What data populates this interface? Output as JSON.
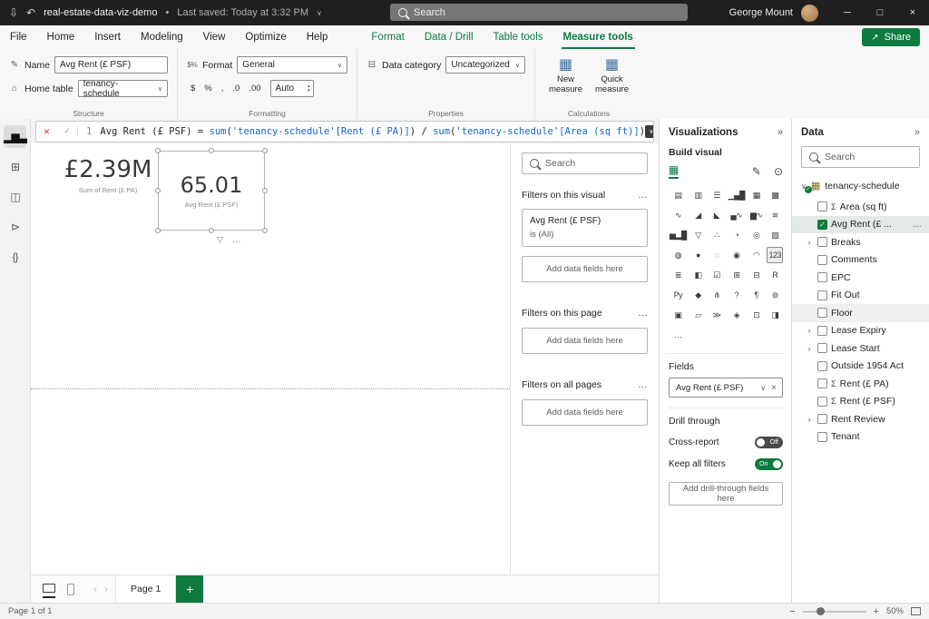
{
  "glyphs": {
    "chevron_down": "∨",
    "chevron_right": "›",
    "collapse": "»",
    "more": "…",
    "check": "✓",
    "close": "×",
    "funnel": "▽",
    "spin_up": "▲",
    "spin_down": "▼",
    "undo": "↶",
    "save": "⇩",
    "share_arrow": "↗",
    "win_min": "─",
    "win_max": "□",
    "win_close": "×",
    "nav_left": "‹",
    "nav_right": "›",
    "zoom_minus": "−",
    "zoom_plus": "+"
  },
  "title_bar": {
    "file_name": "real-estate-data-viz-demo",
    "separator": "•",
    "last_saved": "Last saved: Today at 3:32 PM",
    "search_placeholder": "Search",
    "user_name": "George Mount"
  },
  "ribbon": {
    "tabs": [
      "File",
      "Home",
      "Insert",
      "Modeling",
      "View",
      "Optimize",
      "Help"
    ],
    "contextual_tabs": [
      "Format",
      "Data / Drill",
      "Table tools",
      "Measure tools"
    ],
    "active_contextual_tab": "Measure tools",
    "share_label": "Share",
    "structure": {
      "group_label": "Structure",
      "name_label": "Name",
      "name_value": "Avg Rent (£ PSF)",
      "home_table_label": "Home table",
      "home_table_value": "tenancy-schedule"
    },
    "formatting": {
      "group_label": "Formatting",
      "format_label": "Format",
      "format_value": "General",
      "buttons": [
        "$",
        "%",
        ",",
        ".0",
        ".00"
      ],
      "auto_value": "Auto"
    },
    "properties": {
      "group_label": "Properties",
      "data_category_label": "Data category",
      "data_category_value": "Uncategorized"
    },
    "calculations": {
      "group_label": "Calculations",
      "new_measure_label": "New measure",
      "quick_measure_label": "Quick measure"
    }
  },
  "formula_bar": {
    "line_number": "1",
    "tokens": [
      {
        "t": "Avg Rent (£ PSF) ",
        "c": "k"
      },
      {
        "t": "= ",
        "c": "k"
      },
      {
        "t": "sum",
        "c": "f"
      },
      {
        "t": "(",
        "c": "k"
      },
      {
        "t": "'tenancy-schedule'",
        "c": "s"
      },
      {
        "t": "[Rent (£ PA)]",
        "c": "col"
      },
      {
        "t": ")",
        "c": "k"
      },
      {
        "t": " / ",
        "c": "k"
      },
      {
        "t": "sum",
        "c": "f"
      },
      {
        "t": "(",
        "c": "k"
      },
      {
        "t": "'tenancy-schedule'",
        "c": "s"
      },
      {
        "t": "[Area (sq ft)]",
        "c": "col"
      },
      {
        "t": ")",
        "c": "k"
      }
    ]
  },
  "view_rail": [
    {
      "name": "report-view",
      "glyph": "▂▆▃",
      "selected": true
    },
    {
      "name": "table-view",
      "glyph": "⊞",
      "selected": false
    },
    {
      "name": "model-view",
      "glyph": "◫",
      "selected": false
    },
    {
      "name": "dax-query-view",
      "glyph": "⊳",
      "selected": false
    },
    {
      "name": "tmdl-view",
      "glyph": "{}",
      "selected": false
    }
  ],
  "canvas": {
    "cards": [
      {
        "value": "£2.39M",
        "label": "Sum of Rent (£ PA)",
        "selected": false
      },
      {
        "value": "65.01",
        "label": "Avg Rent (£ PSF)",
        "selected": true
      }
    ]
  },
  "filters_pane": {
    "search_placeholder": "Search",
    "sections": [
      {
        "title": "Filters on this visual",
        "more": "…",
        "cards": [
          {
            "title": "Avg Rent (£ PSF)",
            "condition": "is (All)"
          }
        ],
        "add_hint": "Add data fields here"
      },
      {
        "title": "Filters on this page",
        "more": "…",
        "cards": [],
        "add_hint": "Add data fields here"
      },
      {
        "title": "Filters on all pages",
        "more": "…",
        "cards": [],
        "add_hint": "Add data fields here"
      }
    ]
  },
  "visualizations_pane": {
    "title": "Visualizations",
    "build_label": "Build visual",
    "visual_types": [
      {
        "name": "stacked-bar-chart",
        "glyph": "▤"
      },
      {
        "name": "stacked-column-chart",
        "glyph": "▥"
      },
      {
        "name": "clustered-bar-chart",
        "glyph": "☰"
      },
      {
        "name": "clustered-column-chart",
        "glyph": "▁▄█"
      },
      {
        "name": "100-stacked-bar-chart",
        "glyph": "▦"
      },
      {
        "name": "100-stacked-column-chart",
        "glyph": "▩"
      },
      {
        "name": "line-chart",
        "glyph": "∿"
      },
      {
        "name": "area-chart",
        "glyph": "◢"
      },
      {
        "name": "stacked-area-chart",
        "glyph": "◣"
      },
      {
        "name": "line-and-stacked-column-chart",
        "glyph": "▄∿"
      },
      {
        "name": "line-and-clustered-column-chart",
        "glyph": "▆∿"
      },
      {
        "name": "ribbon-chart",
        "glyph": "≋"
      },
      {
        "name": "waterfall-chart",
        "glyph": "▅▂█"
      },
      {
        "name": "funnel-chart",
        "glyph": "▽"
      },
      {
        "name": "scatter-chart",
        "glyph": "∴"
      },
      {
        "name": "pie-chart",
        "glyph": "◔"
      },
      {
        "name": "donut-chart",
        "glyph": "◎"
      },
      {
        "name": "treemap",
        "glyph": "▧"
      },
      {
        "name": "map",
        "glyph": "◍"
      },
      {
        "name": "filled-map",
        "glyph": "●"
      },
      {
        "name": "shape-map",
        "glyph": "◌"
      },
      {
        "name": "azure-map",
        "glyph": "◉"
      },
      {
        "name": "gauge",
        "glyph": "◠"
      },
      {
        "name": "card",
        "glyph": "123",
        "selected": true
      },
      {
        "name": "multi-row-card",
        "glyph": "≣"
      },
      {
        "name": "kpi",
        "glyph": "◧"
      },
      {
        "name": "slicer",
        "glyph": "☑"
      },
      {
        "name": "table",
        "glyph": "⊞"
      },
      {
        "name": "matrix",
        "glyph": "⊟"
      },
      {
        "name": "r-script-visual",
        "glyph": "R"
      },
      {
        "name": "python-visual",
        "glyph": "Py"
      },
      {
        "name": "key-influencers",
        "glyph": "◆"
      },
      {
        "name": "decomposition-tree",
        "glyph": "⋔"
      },
      {
        "name": "q-and-a",
        "glyph": "?"
      },
      {
        "name": "smart-narrative",
        "glyph": "¶"
      },
      {
        "name": "metrics",
        "glyph": "⊚"
      },
      {
        "name": "paginated-report",
        "glyph": "▣"
      },
      {
        "name": "power-apps",
        "glyph": "▱"
      },
      {
        "name": "power-automate",
        "glyph": "≫"
      },
      {
        "name": "arcgis-map",
        "glyph": "◈"
      },
      {
        "name": "new-card",
        "glyph": "⊡"
      },
      {
        "name": "new-slicer",
        "glyph": "◨"
      },
      {
        "name": "more-visuals",
        "glyph": "…"
      }
    ],
    "fields_label": "Fields",
    "field_well_value": "Avg Rent (£ PSF)",
    "drill_through_label": "Drill through",
    "cross_report_label": "Cross-report",
    "cross_report_state": "Off",
    "keep_all_filters_label": "Keep all filters",
    "keep_all_filters_state": "On",
    "drill_hint": "Add drill-through fields here"
  },
  "data_pane": {
    "title": "Data",
    "search_placeholder": "Search",
    "table_name": "tenancy-schedule",
    "fields": [
      {
        "label": "Area (sq ft)",
        "sigma": true
      },
      {
        "label": "Avg Rent (£ ...",
        "checked": true,
        "highlight": true,
        "more": "…"
      },
      {
        "label": "Breaks",
        "expandable": true
      },
      {
        "label": "Comments"
      },
      {
        "label": "EPC"
      },
      {
        "label": "Fit Out"
      },
      {
        "label": "Floor",
        "hover": true
      },
      {
        "label": "Lease Expiry",
        "expandable": true
      },
      {
        "label": "Lease Start",
        "expandable": true
      },
      {
        "label": "Outside 1954 Act"
      },
      {
        "label": "Rent (£ PA)",
        "sigma": true
      },
      {
        "label": "Rent (£ PSF)",
        "sigma": true
      },
      {
        "label": "Rent Review",
        "expandable": true
      },
      {
        "label": "Tenant"
      }
    ]
  },
  "page_bar": {
    "page_tab_label": "Page 1",
    "add_label": "+"
  },
  "status_bar": {
    "left": "Page 1 of 1",
    "zoom": "50%"
  }
}
